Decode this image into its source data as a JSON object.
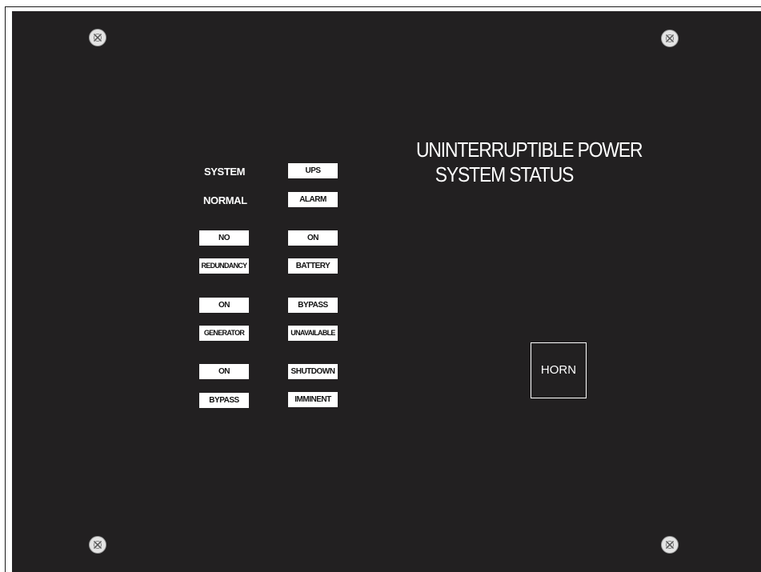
{
  "title": {
    "line1": "UNINTERRUPTIBLE POWER",
    "line2": "SYSTEM STATUS"
  },
  "system_label": {
    "line1": "SYSTEM",
    "line2": "NORMAL"
  },
  "indicators": {
    "ups_alarm": {
      "line1": "UPS",
      "line2": "ALARM"
    },
    "no_redundancy": {
      "line1": "NO",
      "line2": "REDUNDANCY"
    },
    "on_battery": {
      "line1": "ON",
      "line2": "BATTERY"
    },
    "on_generator": {
      "line1": "ON",
      "line2": "GENERATOR"
    },
    "bypass_unavailable": {
      "line1": "BYPASS",
      "line2": "UNAVAILABLE"
    },
    "on_bypass": {
      "line1": "ON",
      "line2": "BYPASS"
    },
    "shutdown_imminent": {
      "line1": "SHUTDOWN",
      "line2": "IMMINENT"
    }
  },
  "horn": {
    "label": "HORN"
  },
  "colors": {
    "panel": "#222021",
    "label_plate": "#ffffff",
    "text_on_panel": "#ffffff",
    "text_on_plate": "#111111",
    "screw": "#e4e4e4"
  },
  "icons": [
    "screw-icon"
  ]
}
